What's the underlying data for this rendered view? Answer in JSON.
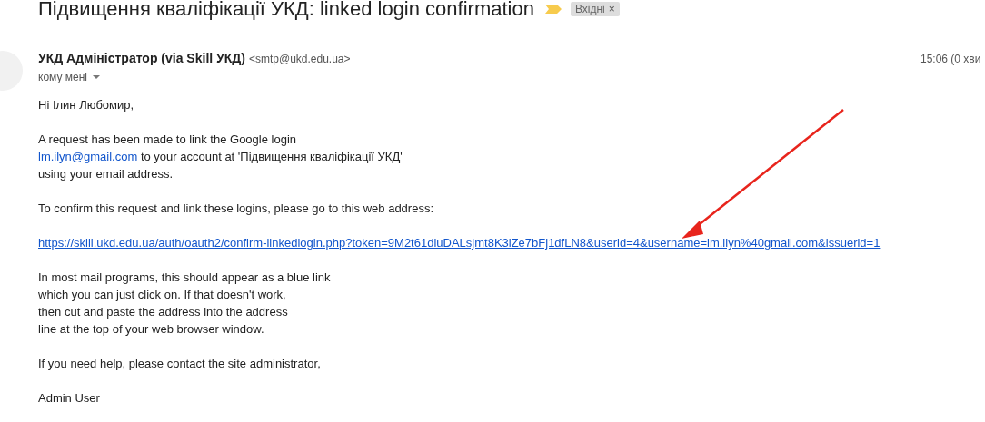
{
  "subject": "Підвищення кваліфікації УКД: linked login confirmation",
  "important": true,
  "labels": [
    {
      "text": "Вхідні",
      "close": "×"
    }
  ],
  "sender": {
    "name": "УКД Адміністратор (via Skill УКД)",
    "email": "<smtp@ukd.edu.ua>"
  },
  "recipient": "кому мені",
  "time": "15:06 (0 хви",
  "body": [
    {
      "lines": [
        [
          {
            "kind": "text",
            "text": "Ні Ілин Любомир,"
          }
        ]
      ]
    },
    {
      "lines": [
        [
          {
            "kind": "text",
            "text": "A request has been made to link the Google login"
          }
        ],
        [
          {
            "kind": "link",
            "text": "lm.ilyn@gmail.com"
          },
          {
            "kind": "text",
            "text": " to your account at 'Підвищення кваліфікації УКД'"
          }
        ],
        [
          {
            "kind": "text",
            "text": "using your email address."
          }
        ]
      ]
    },
    {
      "lines": [
        [
          {
            "kind": "text",
            "text": "To confirm this request and link these logins, please go to this web address:"
          }
        ]
      ]
    },
    {
      "lines": [
        [
          {
            "kind": "link",
            "text": "https://skill.ukd.edu.ua/auth/oauth2/confirm-linkedlogin.php?token=9M2t61diuDALsjmt8K3lZe7bFj1dfLN8&userid=4&username=lm.ilyn%40gmail.com&issuerid=1"
          }
        ]
      ]
    },
    {
      "lines": [
        [
          {
            "kind": "text",
            "text": "In most mail programs, this should appear as a blue link"
          }
        ],
        [
          {
            "kind": "text",
            "text": "which you can just click on. If that doesn't work,"
          }
        ],
        [
          {
            "kind": "text",
            "text": "then cut and paste the address into the address"
          }
        ],
        [
          {
            "kind": "text",
            "text": "line at the top of your web browser window."
          }
        ]
      ]
    },
    {
      "lines": [
        [
          {
            "kind": "text",
            "text": "If you need help, please contact the site administrator,"
          }
        ]
      ]
    },
    {
      "lines": [
        [
          {
            "kind": "text",
            "text": "Admin User"
          }
        ]
      ]
    }
  ]
}
